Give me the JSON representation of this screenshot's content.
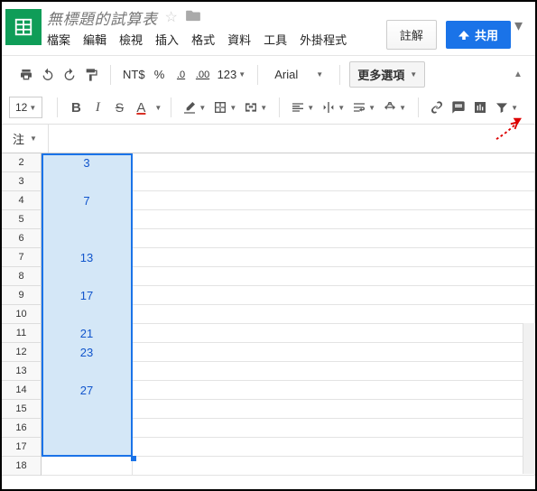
{
  "header": {
    "title": "無標題的試算表",
    "menus": [
      "檔案",
      "編輯",
      "檢視",
      "插入",
      "格式",
      "資料",
      "工具",
      "外掛程式"
    ],
    "comments_btn": "註解",
    "share_btn": "共用"
  },
  "toolbar1": {
    "currency": "NT$",
    "percent": "%",
    "dec_dec": ".0",
    "inc_dec": ".00",
    "num_fmt": "123",
    "font": "Arial",
    "more_options": "更多選項"
  },
  "toolbar2": {
    "font_size": "12",
    "bold": "B",
    "italic": "I",
    "strike": "S",
    "textcolor": "A"
  },
  "namebox": {
    "label": "注"
  },
  "grid": {
    "row_numbers": [
      2,
      3,
      4,
      5,
      6,
      7,
      8,
      9,
      10,
      11,
      12,
      13,
      14,
      15,
      16,
      17,
      18
    ],
    "col_a_values": {
      "2": "3",
      "4": "7",
      "7": "13",
      "9": "17",
      "11": "21",
      "12": "23",
      "14": "27"
    },
    "selection": {
      "from_row": 2,
      "to_row": 17
    }
  },
  "icons": {
    "print": "print-icon",
    "undo": "undo-icon",
    "redo": "redo-icon",
    "paint": "paint-format-icon",
    "fill": "fill-color-icon",
    "borders": "borders-icon",
    "merge": "merge-cells-icon",
    "halign": "horizontal-align-icon",
    "valign": "vertical-align-icon",
    "wrap": "text-wrap-icon",
    "rotate": "text-rotation-icon",
    "link": "insert-link-icon",
    "comment": "insert-comment-icon",
    "chart": "insert-chart-icon",
    "filter": "filter-icon"
  }
}
